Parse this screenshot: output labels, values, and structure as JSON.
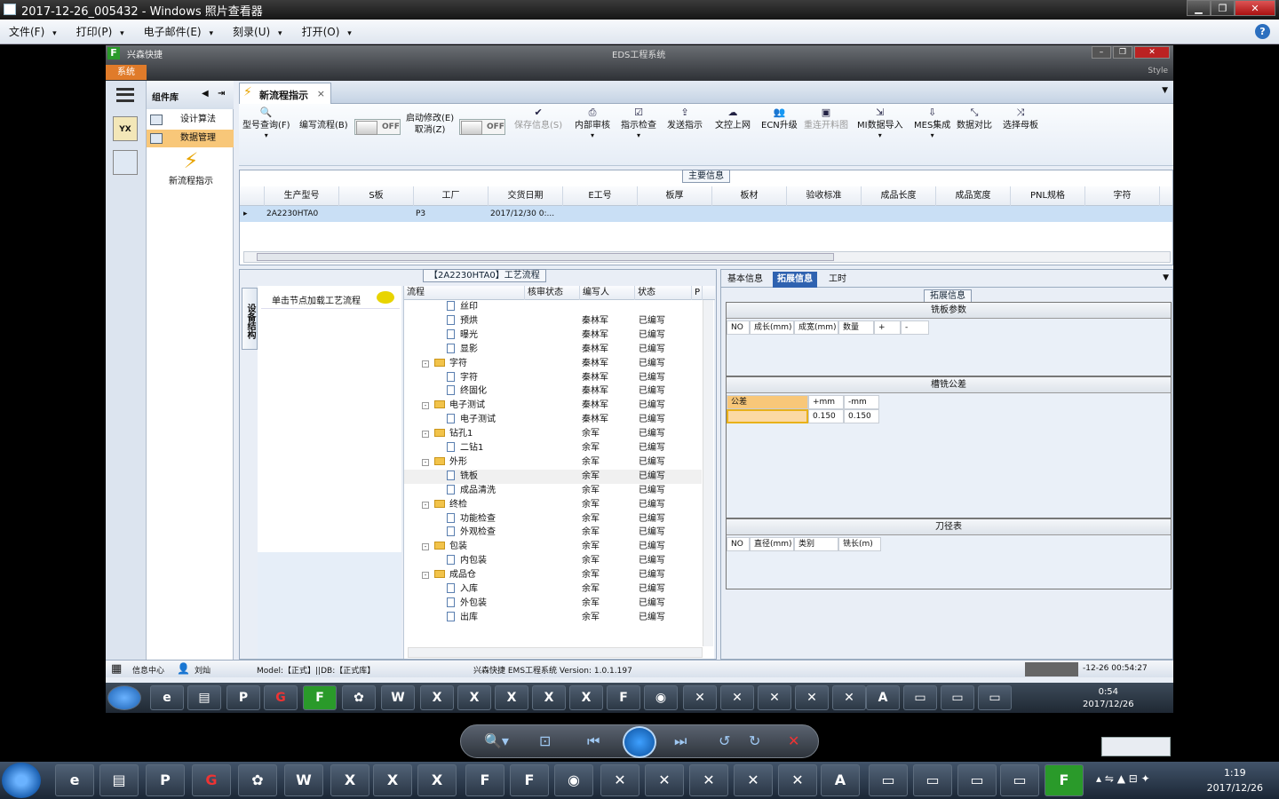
{
  "window": {
    "title": "2017-12-26_005432 - Windows 照片查看器"
  },
  "menu": [
    "文件(F)",
    "打印(P)",
    "电子邮件(E)",
    "刻录(U)",
    "打开(O)"
  ],
  "app": {
    "brand": "兴森快捷",
    "title": "EDS工程系统",
    "system_tab": "系统",
    "style_label": "Style",
    "left_logo": "YX"
  },
  "components": {
    "header": "组件库",
    "items": [
      "设计算法",
      "数据管理"
    ],
    "new_flow": "新流程指示"
  },
  "tab": {
    "label": "新流程指示"
  },
  "toolbar": {
    "buttons": [
      "型号查询(F)",
      "编写流程(B)",
      "启动修改(E)",
      "取消(Z)",
      "保存信息(S)",
      "内部审核",
      "指示检查",
      "发送指示",
      "文控上网",
      "ECN升级",
      "重连开料图",
      "MI数据导入",
      "MES集成",
      "数据对比",
      "选择母板"
    ],
    "toggle_off": "OFF"
  },
  "main_info": {
    "title": "主要信息",
    "columns": [
      "生产型号",
      "S板",
      "工厂",
      "交货日期",
      "E工号",
      "板厚",
      "板材",
      "验收标准",
      "成品长度",
      "成品宽度",
      "PNL规格",
      "字符"
    ],
    "row": [
      "2A2230HTA0",
      "",
      "P3",
      "2017/12/30 0:..."
    ]
  },
  "process": {
    "title": "【2A2230HTA0】工艺流程",
    "side_tab": "设备结构",
    "load_hint": "单击节点加载工艺流程",
    "columns": [
      "流程",
      "核审状态",
      "编写人",
      "状态",
      "P"
    ],
    "rows": [
      {
        "name": "丝印",
        "type": "doc",
        "level": 2,
        "writer": "",
        "status": ""
      },
      {
        "name": "预烘",
        "type": "doc",
        "level": 2,
        "writer": "秦林军",
        "status": "已编写"
      },
      {
        "name": "曝光",
        "type": "doc",
        "level": 2,
        "writer": "秦林军",
        "status": "已编写"
      },
      {
        "name": "显影",
        "type": "doc",
        "level": 2,
        "writer": "秦林军",
        "status": "已编写"
      },
      {
        "name": "字符",
        "type": "folder",
        "level": 1,
        "writer": "秦林军",
        "status": "已编写"
      },
      {
        "name": "字符",
        "type": "doc",
        "level": 2,
        "writer": "秦林军",
        "status": "已编写"
      },
      {
        "name": "终固化",
        "type": "doc",
        "level": 2,
        "writer": "秦林军",
        "status": "已编写"
      },
      {
        "name": "电子测试",
        "type": "folder",
        "level": 1,
        "writer": "秦林军",
        "status": "已编写"
      },
      {
        "name": "电子测试",
        "type": "doc",
        "level": 2,
        "writer": "秦林军",
        "status": "已编写"
      },
      {
        "name": "钻孔1",
        "type": "folder",
        "level": 1,
        "writer": "余军",
        "status": "已编写"
      },
      {
        "name": "二钻1",
        "type": "doc",
        "level": 2,
        "writer": "余军",
        "status": "已编写"
      },
      {
        "name": "外形",
        "type": "folder",
        "level": 1,
        "writer": "余军",
        "status": "已编写"
      },
      {
        "name": "铣板",
        "type": "doc",
        "level": 2,
        "writer": "余军",
        "status": "已编写"
      },
      {
        "name": "成品清洗",
        "type": "doc",
        "level": 2,
        "writer": "余军",
        "status": "已编写"
      },
      {
        "name": "终检",
        "type": "folder",
        "level": 1,
        "writer": "余军",
        "status": "已编写"
      },
      {
        "name": "功能检查",
        "type": "doc",
        "level": 2,
        "writer": "余军",
        "status": "已编写"
      },
      {
        "name": "外观检查",
        "type": "doc",
        "level": 2,
        "writer": "余军",
        "status": "已编写"
      },
      {
        "name": "包装",
        "type": "folder",
        "level": 1,
        "writer": "余军",
        "status": "已编写"
      },
      {
        "name": "内包装",
        "type": "doc",
        "level": 2,
        "writer": "余军",
        "status": "已编写"
      },
      {
        "name": "成品仓",
        "type": "folder",
        "level": 1,
        "writer": "余军",
        "status": "已编写"
      },
      {
        "name": "入库",
        "type": "doc",
        "level": 2,
        "writer": "余军",
        "status": "已编写"
      },
      {
        "name": "外包装",
        "type": "doc",
        "level": 2,
        "writer": "余军",
        "status": "已编写"
      },
      {
        "name": "出库",
        "type": "doc",
        "level": 2,
        "writer": "余军",
        "status": "已编写"
      }
    ]
  },
  "right": {
    "tabs": [
      "基本信息",
      "拓展信息",
      "工时"
    ],
    "section_title": "拓展信息",
    "mill_params": {
      "title": "铣板参数",
      "cols": [
        "NO",
        "成长(mm)",
        "成宽(mm)",
        "数量",
        "+",
        "-"
      ]
    },
    "tolerance": {
      "title": "槽铣公差",
      "cols": [
        "公差",
        "+mm",
        "-mm"
      ],
      "values": [
        "0.150",
        "0.150"
      ]
    },
    "cutter": {
      "title": "刀径表",
      "cols": [
        "NO",
        "直径(mm)",
        "类别",
        "铣长(m)"
      ]
    }
  },
  "status": {
    "info_center": "信息中心",
    "user": "刘灿",
    "model": "Model:【正式】||DB:【正式库】",
    "version": "兴森快捷 EMS工程系统 Version: 1.0.1.197",
    "time": "-12-26 00:54:27"
  },
  "inner_clock": {
    "time": "0:54",
    "date": "2017/12/26"
  },
  "taskbar_clock": {
    "time": "1:19",
    "date": "2017/12/26"
  }
}
